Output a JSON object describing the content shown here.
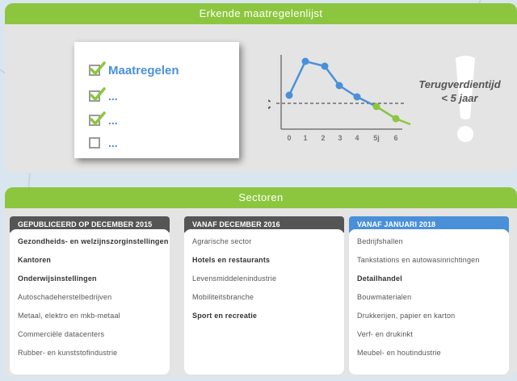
{
  "top": {
    "banner": "Erkende maatregelenlijst",
    "checklist": {
      "items": [
        {
          "label": "Maatregelen",
          "checked": true
        },
        {
          "label": "...",
          "checked": true
        },
        {
          "label": "...",
          "checked": true
        },
        {
          "label": "...",
          "checked": false
        }
      ]
    },
    "chart": {
      "currency_symbol": "€",
      "x_labels": [
        "0",
        "1",
        "2",
        "3",
        "4",
        "5j",
        "6"
      ]
    },
    "payback": {
      "line1": "Terugverdientijd",
      "line2": "< 5 jaar"
    },
    "exclamation": "!"
  },
  "bottom": {
    "banner": "Sectoren",
    "columns": [
      {
        "header": "GEPUBLICEERD OP  DECEMBER 2015",
        "header_color": "#555555",
        "items": [
          {
            "text": "Gezondheids- en welzijnszorginstellingen",
            "bold": true
          },
          {
            "text": "Kantoren",
            "bold": true
          },
          {
            "text": "Onderwijsinstellingen",
            "bold": true
          },
          {
            "text": "Autoschadeherstelbedrijven",
            "bold": false
          },
          {
            "text": "Metaal, elektro en mkb-metaal",
            "bold": false
          },
          {
            "text": "Commerciële datacenters",
            "bold": false
          },
          {
            "text": "Rubber- en kunststofindustrie",
            "bold": false
          }
        ]
      },
      {
        "header": "VANAF DECEMBER 2016",
        "header_color": "#555555",
        "items": [
          {
            "text": "Agrarische sector",
            "bold": false
          },
          {
            "text": "Hotels en restaurants",
            "bold": true
          },
          {
            "text": "Levensmiddelenindustrie",
            "bold": false
          },
          {
            "text": "Mobiliteitsbranche",
            "bold": false
          },
          {
            "text": "Sport en recreatie",
            "bold": true
          }
        ]
      },
      {
        "header": "VANAF JANUARI 2018",
        "header_color": "#4a90d9",
        "items": [
          {
            "text": "Bedrijfshallen",
            "bold": false
          },
          {
            "text": "Tankstations en autowasinrichtingen",
            "bold": false
          },
          {
            "text": "Detailhandel",
            "bold": true
          },
          {
            "text": "Bouwmaterialen",
            "bold": false
          },
          {
            "text": "Drukkerijen, papier en karton",
            "bold": false
          },
          {
            "text": "Verf- en drukinkt",
            "bold": false
          },
          {
            "text": "Meubel- en houtindustrie",
            "bold": false
          }
        ]
      }
    ]
  },
  "colors": {
    "green": "#8cc63e",
    "blue": "#4a90d9",
    "dark": "#555555",
    "panel": "#e4e4e4"
  }
}
